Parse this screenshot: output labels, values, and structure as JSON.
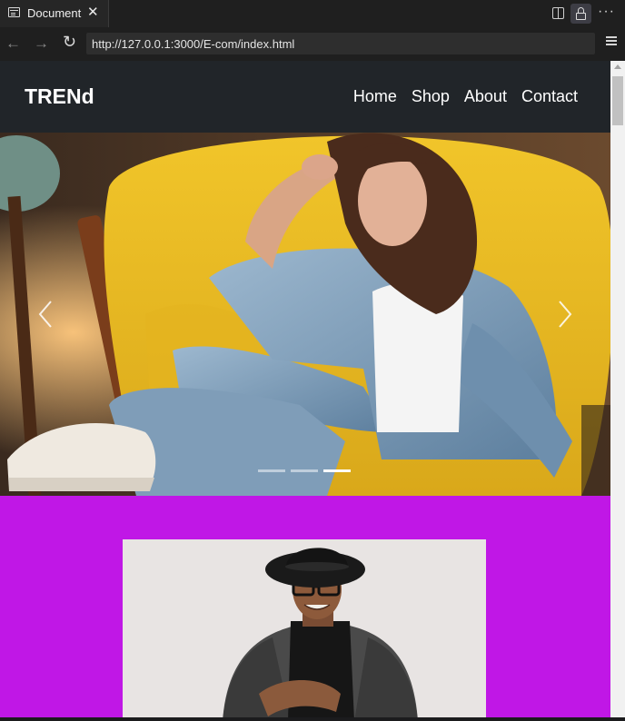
{
  "browser": {
    "tab_title": "Document",
    "url": "http://127.0.0.1:3000/E-com/index.html",
    "icons": [
      "page-icon",
      "close-icon",
      "split-screen-icon",
      "lock-icon",
      "more-icon",
      "back-icon",
      "forward-icon",
      "reload-icon",
      "menu-icon"
    ]
  },
  "site": {
    "brand": "TRENd",
    "nav": [
      "Home",
      "Shop",
      "About",
      "Contact"
    ]
  },
  "carousel": {
    "slide_count": 3,
    "active_slide": 3,
    "prev_icon": "chevron-left-icon",
    "next_icon": "chevron-right-icon"
  },
  "colors": {
    "header_bg": "#212529",
    "section_bg": "#c017e6",
    "card_bg": "#e8e4e3"
  }
}
